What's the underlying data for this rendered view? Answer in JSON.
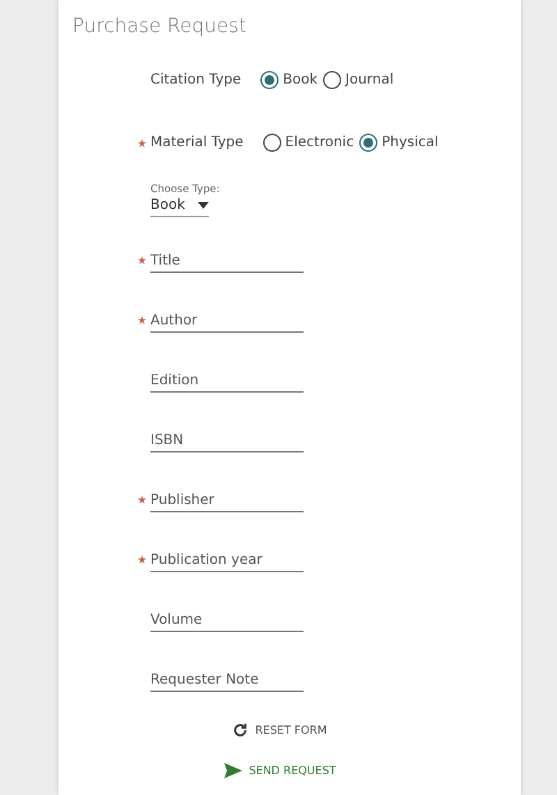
{
  "title": "Purchase Request",
  "citation_type": {
    "label": "Citation Type",
    "required": false,
    "options": [
      {
        "label": "Book",
        "selected": true
      },
      {
        "label": "Journal",
        "selected": false
      }
    ]
  },
  "material_type": {
    "label": "Material Type",
    "required": true,
    "options": [
      {
        "label": "Electronic",
        "selected": false
      },
      {
        "label": "Physical",
        "selected": true
      }
    ]
  },
  "choose_type": {
    "label": "Choose Type:",
    "value": "Book"
  },
  "fields": [
    {
      "placeholder": "Title",
      "required": true
    },
    {
      "placeholder": "Author",
      "required": true
    },
    {
      "placeholder": "Edition",
      "required": false
    },
    {
      "placeholder": "ISBN",
      "required": false
    },
    {
      "placeholder": "Publisher",
      "required": true
    },
    {
      "placeholder": "Publication year",
      "required": true
    },
    {
      "placeholder": "Volume",
      "required": false
    },
    {
      "placeholder": "Requester Note",
      "required": false
    }
  ],
  "buttons": [
    {
      "kind": "reset",
      "label": "RESET FORM"
    },
    {
      "kind": "send",
      "label": "SEND REQUEST"
    }
  ]
}
